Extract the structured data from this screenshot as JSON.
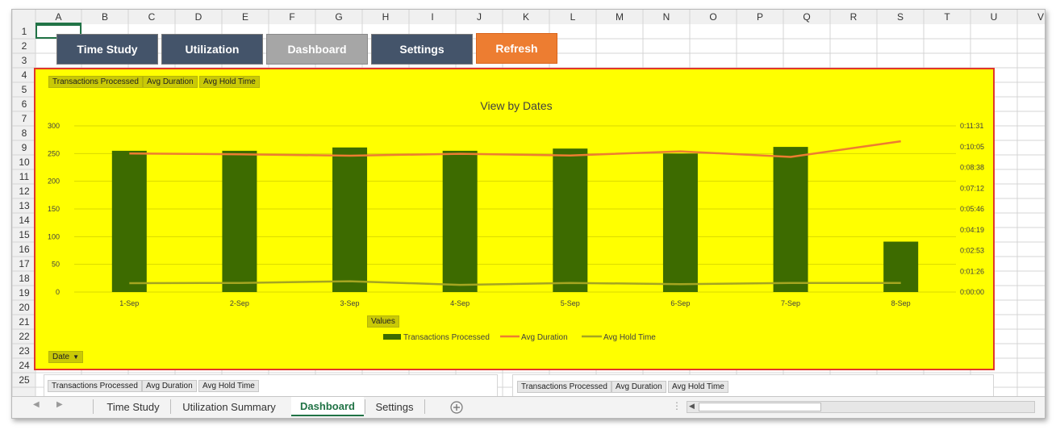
{
  "sheet": {
    "columns": [
      "A",
      "B",
      "C",
      "D",
      "E",
      "F",
      "G",
      "H",
      "I",
      "J",
      "K",
      "L",
      "M",
      "N",
      "O",
      "P",
      "Q",
      "R",
      "S",
      "T",
      "U",
      "V"
    ],
    "rows": [
      "1",
      "2",
      "3",
      "4",
      "5",
      "6",
      "7",
      "8",
      "9",
      "10",
      "11",
      "12",
      "13",
      "14",
      "15",
      "16",
      "17",
      "18",
      "19",
      "20",
      "21",
      "22",
      "23",
      "24",
      "25"
    ],
    "selected_cell": "A1"
  },
  "buttons": {
    "time_study": "Time Study",
    "utilization": "Utilization",
    "dashboard": "Dashboard",
    "settings": "Settings",
    "refresh": "Refresh"
  },
  "field_buttons": {
    "transactions": "Transactions Processed",
    "avg_duration": "Avg Duration",
    "avg_hold": "Avg Hold Time",
    "values": "Values",
    "date": "Date"
  },
  "colors": {
    "chart_bg": "#ffff00",
    "bar": "#3d6b00",
    "avg_duration_line": "#ed7d31",
    "avg_hold_line": "#a5a521",
    "border": "#e0362b",
    "button_dark": "#44546a",
    "button_orange": "#ed7d31"
  },
  "chart_data": {
    "type": "bar",
    "title": "View by Dates",
    "categories": [
      "1-Sep",
      "2-Sep",
      "3-Sep",
      "4-Sep",
      "5-Sep",
      "6-Sep",
      "7-Sep",
      "8-Sep"
    ],
    "series": [
      {
        "name": "Transactions Processed",
        "type": "bar",
        "axis": "left",
        "values": [
          255,
          255,
          261,
          255,
          259,
          250,
          262,
          91
        ]
      },
      {
        "name": "Avg Duration",
        "type": "line",
        "axis": "right",
        "values": [
          "0:09:36",
          "0:09:33",
          "0:09:27",
          "0:09:35",
          "0:09:28",
          "0:09:45",
          "0:09:22",
          "0:10:27"
        ]
      },
      {
        "name": "Avg Hold Time",
        "type": "line",
        "axis": "right",
        "values": [
          "0:00:37",
          "0:00:38",
          "0:00:45",
          "0:00:30",
          "0:00:38",
          "0:00:33",
          "0:00:38",
          "0:00:38"
        ]
      }
    ],
    "y_left": {
      "ticks": [
        "0",
        "50",
        "100",
        "150",
        "200",
        "250",
        "300"
      ],
      "ylim": [
        0,
        300
      ]
    },
    "y_right": {
      "ticks": [
        "0:00:00",
        "0:01:26",
        "0:02:53",
        "0:04:19",
        "0:05:46",
        "0:07:12",
        "0:08:38",
        "0:10:05",
        "0:11:31"
      ],
      "ylim": [
        "0:00:00",
        "0:11:31"
      ]
    },
    "gridlines": true,
    "legend_position": "bottom"
  },
  "sheet_tabs": [
    "Time Study",
    "Utilization Summary",
    "Dashboard",
    "Settings"
  ],
  "active_tab": "Dashboard",
  "icons": {
    "add_sheet": "plus-circle-icon",
    "nav_prev": "triangle-left-icon",
    "nav_next": "triangle-right-icon",
    "dropdown": "triangle-down-icon"
  }
}
